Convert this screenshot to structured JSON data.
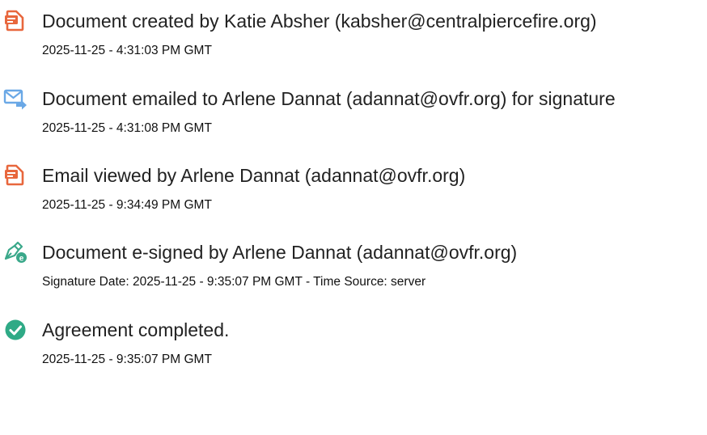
{
  "events": [
    {
      "icon": "document-created-icon",
      "title": "Document created by Katie Absher (kabsher@centralpiercefire.org)",
      "detail": "2025-11-25 - 4:31:03 PM GMT"
    },
    {
      "icon": "email-sent-icon",
      "title": "Document emailed to Arlene Dannat (adannat@ovfr.org) for signature",
      "detail": "2025-11-25 - 4:31:08 PM GMT"
    },
    {
      "icon": "email-viewed-icon",
      "title": "Email viewed by Arlene Dannat (adannat@ovfr.org)",
      "detail": "2025-11-25 - 9:34:49 PM GMT"
    },
    {
      "icon": "e-signed-icon",
      "title": "Document e-signed by Arlene Dannat (adannat@ovfr.org)",
      "detail": "Signature Date: 2025-11-25 - 9:35:07 PM GMT - Time Source: server"
    },
    {
      "icon": "agreement-completed-icon",
      "title": "Agreement completed.",
      "detail": "2025-11-25 - 9:35:07 PM GMT"
    }
  ],
  "colors": {
    "document_icon": "#e8673d",
    "email_icon": "#6aa8e6",
    "sign_icon": "#3aa88a",
    "completed_icon": "#2faa86"
  }
}
